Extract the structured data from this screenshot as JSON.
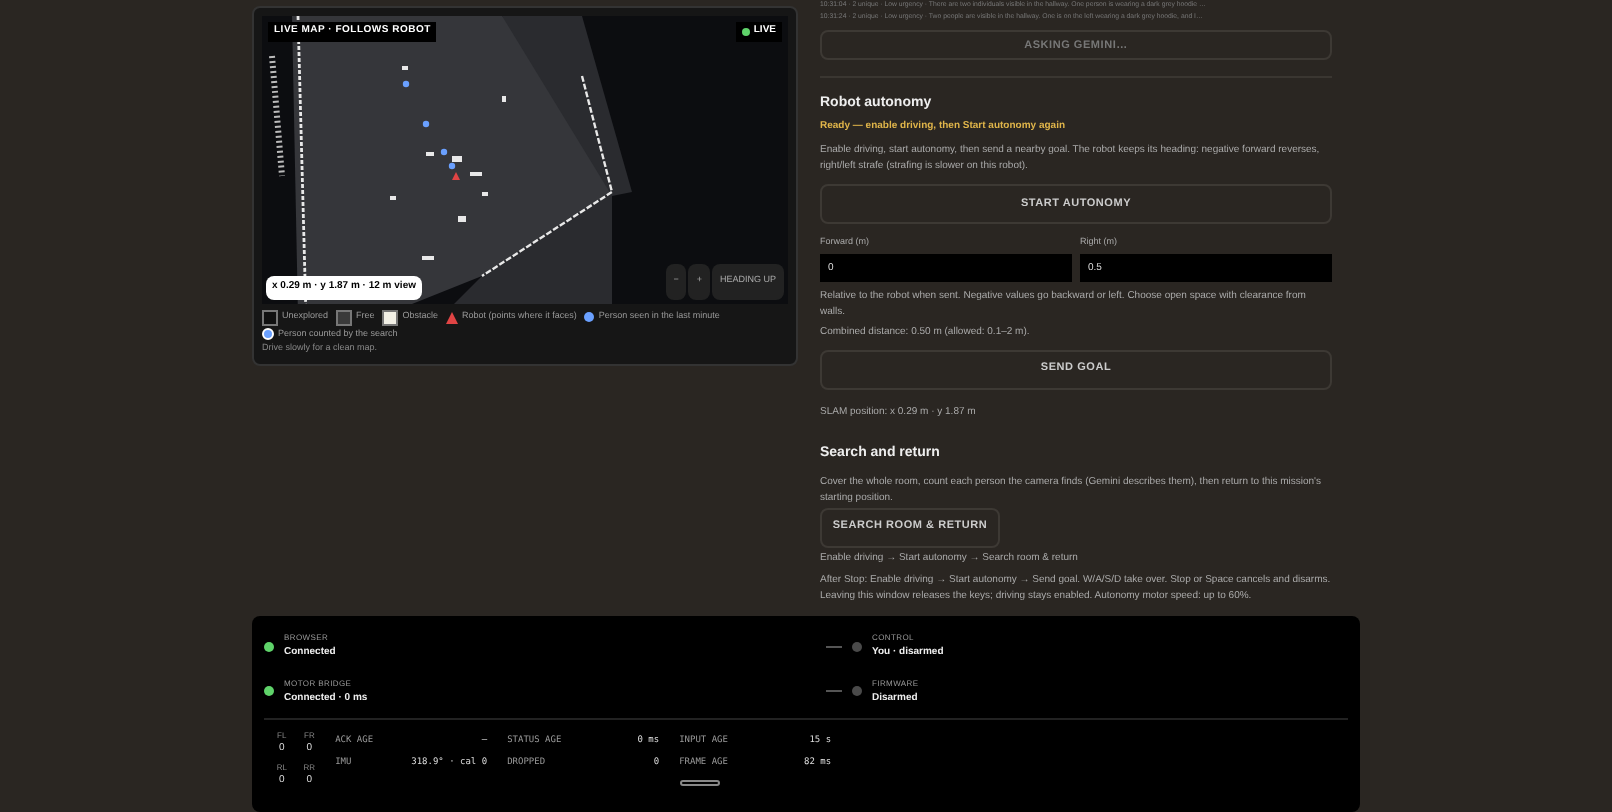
{
  "map": {
    "title": "LIVE MAP · FOLLOWS ROBOT",
    "live": {
      "label": "LIVE",
      "on": true
    },
    "position": "x 0.29 m · y 1.87 m · 12 m view",
    "controls": [
      "−",
      "+",
      "HEADING UP"
    ],
    "legend": [
      {
        "kind": "square",
        "label": "Unexplored",
        "color": "#111111"
      },
      {
        "kind": "square",
        "label": "Free",
        "color": "#3a3a3a"
      },
      {
        "kind": "square",
        "label": "Obstacle",
        "color": "#f2f0e6"
      },
      {
        "kind": "triangle",
        "label": "Robot (points where it faces)",
        "color": "#e04444"
      },
      {
        "kind": "dot",
        "label": "Person seen in the last minute",
        "color": "#6aa0ff"
      },
      {
        "kind": "ring",
        "label": "Person counted by the search",
        "color": "#6aa0ff"
      }
    ],
    "hint": "Drive slowly for a clean map."
  },
  "log": [
    "10:31:04 · 2 unique · Low urgency · There are two individuals visible in the hallway. One person is wearing a dark grey hoodie …",
    "10:31:24 · 2 unique · Low urgency · Two people are visible in the hallway. One is on the left wearing a dark grey hoodie, and I…"
  ],
  "ask_button": {
    "label": "ASKING GEMINI…",
    "disabled": true
  },
  "autonomy": {
    "title": "Robot autonomy",
    "status": "Ready — enable driving, then Start autonomy again",
    "description": "Enable driving, start autonomy, then send a nearby goal. The robot keeps its heading: negative forward reverses, right/left strafe (strafing is slower on this robot).",
    "start_button": "START AUTONOMY",
    "fields": [
      {
        "label": "Forward (m)",
        "value": "0"
      },
      {
        "label": "Right (m)",
        "value": "0.5"
      }
    ],
    "help": "Relative to the robot when sent. Negative values go backward or left. Choose open space with clearance from walls.",
    "distance": "Combined distance: 0.50 m (allowed: 0.1–2 m).",
    "send_button": "SEND GOAL",
    "slam": "SLAM position: x 0.29 m · y 1.87 m"
  },
  "search": {
    "title": "Search and return",
    "description": "Cover the whole room, count each person the camera finds (Gemini describes them), then return to this mission's starting position.",
    "button": "SEARCH ROOM & RETURN",
    "steps": "Enable driving → Start autonomy → Search room & return",
    "after": "After Stop: Enable driving → Start autonomy → Send goal. W/A/S/D take over. Stop or Space cancels and disarms. Leaving this window releases the keys; driving stays enabled. Autonomy motor speed: up to 60%."
  },
  "status": [
    {
      "label": "BROWSER",
      "value": "Connected",
      "color": "#5fd36a"
    },
    {
      "label": "CONTROL",
      "value": "You · disarmed",
      "color": "#4a4a4a"
    },
    {
      "label": "MOTOR BRIDGE",
      "value": "Connected · 0 ms",
      "color": "#5fd36a"
    },
    {
      "label": "FIRMWARE",
      "value": "Disarmed",
      "color": "#4a4a4a"
    }
  ],
  "wheels": [
    {
      "label": "FL",
      "value": "0"
    },
    {
      "label": "FR",
      "value": "0"
    },
    {
      "label": "RL",
      "value": "0"
    },
    {
      "label": "RR",
      "value": "0"
    }
  ],
  "metrics": [
    {
      "label": "ACK AGE",
      "value": "—"
    },
    {
      "label": "STATUS AGE",
      "value": "0 ms"
    },
    {
      "label": "INPUT AGE",
      "value": "15 s"
    },
    {
      "label": "IMU",
      "value": "318.9° · cal 0"
    },
    {
      "label": "DROPPED",
      "value": "0"
    },
    {
      "label": "FRAME AGE",
      "value": "82 ms"
    }
  ]
}
